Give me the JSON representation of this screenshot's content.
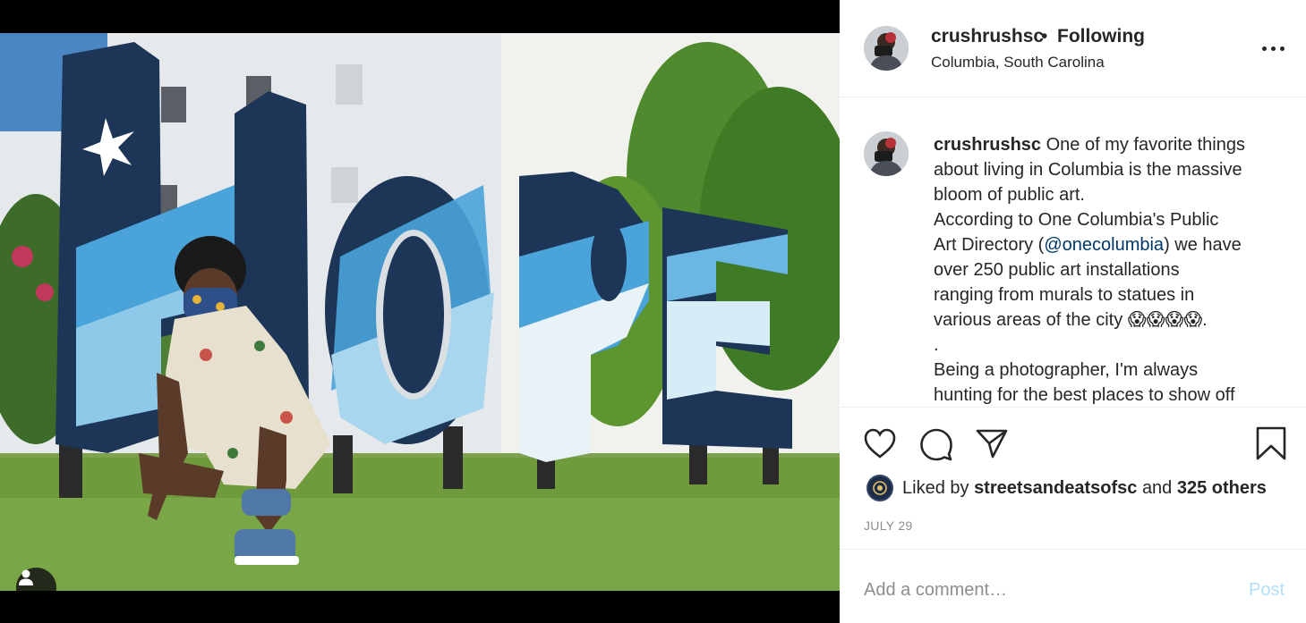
{
  "post": {
    "username": "crushrushsc",
    "separator": "•",
    "follow_status": "Following",
    "location": "Columbia, South Carolina",
    "more_icon": "more-horizontal-icon"
  },
  "photo": {
    "sign_text": "HOPE",
    "user_tag_icon": "user-icon"
  },
  "caption": {
    "username": "crushrushsc",
    "l1": "One of my favorite things",
    "l2": "about living in Columbia is the massive",
    "l3": "bloom of public art.",
    "l4": "According to One Columbia's Public",
    "l5a": "Art Directory (",
    "mention": "@onecolumbia",
    "l5b": ") we have",
    "l6": "over 250 public art installations",
    "l7": "ranging from murals to statues in",
    "l8": "various areas of the city 😱😱😱😱.",
    "l9": ".",
    "l10": "Being a photographer, I'm always",
    "l11": "hunting for the best places to show off"
  },
  "actions": {
    "like_icon": "heart-icon",
    "comment_icon": "comment-icon",
    "share_icon": "share-icon",
    "save_icon": "bookmark-icon"
  },
  "likes": {
    "prefix": "Liked by",
    "by_user": "streetsandeatsofsc",
    "and": "and",
    "others": "325 others"
  },
  "date": "JULY 29",
  "add_comment": {
    "placeholder": "Add a comment…",
    "post_label": "Post"
  }
}
